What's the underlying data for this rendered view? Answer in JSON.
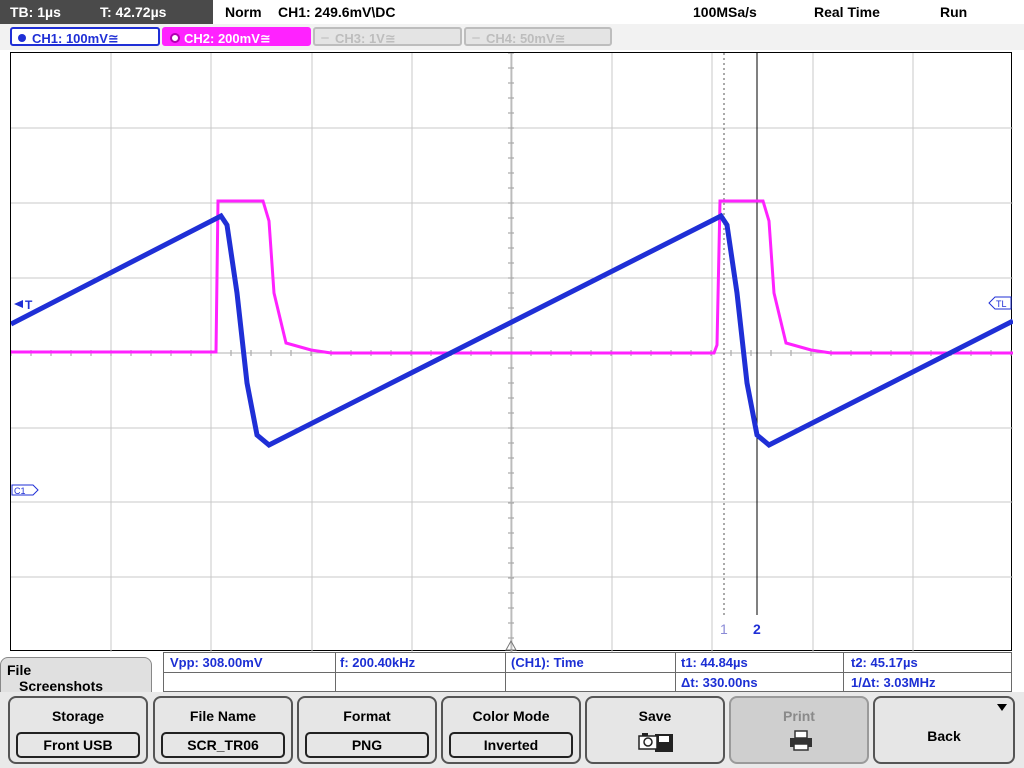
{
  "header": {
    "timebase": "TB: 1µs",
    "trigger_time": "T: 42.72µs",
    "mode": "Norm",
    "trigger_info": "CH1: 249.6mV\\DC",
    "sample_rate": "100MSa/s",
    "acq_mode": "Real Time",
    "run_state": "Run"
  },
  "channels": [
    {
      "label": "CH1: 100mV≅",
      "color": "#1f2fd6",
      "active": true
    },
    {
      "label": "CH2: 200mV≅",
      "color": "#ff22ff",
      "active": true
    },
    {
      "label": "CH3: 1V≅",
      "color": "#bdbdbd",
      "active": false
    },
    {
      "label": "CH4: 50mV≅",
      "color": "#bdbdbd",
      "active": false
    }
  ],
  "screen": {
    "markers": {
      "trigger_level": "T",
      "trigger_level_label": "TL",
      "ch1_ground": "C1",
      "cursor1": "1",
      "cursor2": "2"
    },
    "traces": {
      "ch1_color": "#1f2fd6",
      "ch2_color": "#ff22ff"
    }
  },
  "measurements": {
    "vpp": "Vpp: 308.00mV",
    "freq": "f: 200.40kHz",
    "source": "(CH1): Time",
    "t1": "t1: 44.84µs",
    "t2": "t2: 45.17µs",
    "dt": "Δt: 330.00ns",
    "inv_dt": "1/Δt: 3.03MHz"
  },
  "menu": {
    "title_line1": "File",
    "title_line2": "Screenshots",
    "softkeys": [
      {
        "label": "Storage",
        "value": "Front USB"
      },
      {
        "label": "File Name",
        "value": "SCR_TR06"
      },
      {
        "label": "Format",
        "value": "PNG"
      },
      {
        "label": "Color Mode",
        "value": "Inverted"
      },
      {
        "label": "Save",
        "value": ""
      },
      {
        "label": "Print",
        "value": ""
      },
      {
        "label": "Back",
        "value": ""
      }
    ]
  }
}
